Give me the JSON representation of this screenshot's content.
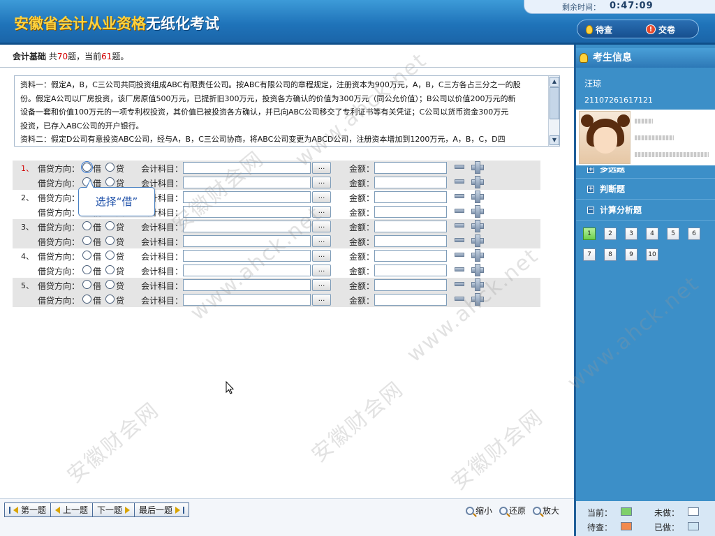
{
  "header": {
    "title_strong": "安徽省会计从业资格",
    "title_weak": "无纸化考试",
    "timer_label": "剩余时间：",
    "timer_value": "0:47:09",
    "pending_label": "待查",
    "submit_label": "交卷"
  },
  "subject": {
    "name": "会计基础",
    "text1": " 共",
    "total": "70",
    "text2": "题，当前",
    "current": "61",
    "text3": "题。"
  },
  "material": {
    "lines": [
      "资料一：假定A，B，C三公司共同投资组成ABC有限责任公司。按ABC有限公司的章程规定，注册资本为900万元，A，B，C三方各占三分之一的股",
      "份。假定A公司以厂房投资，该厂房原值500万元，已提折旧300万元，投资各方确认的价值为300万元（同公允价值）；B公司以价值200万元的新",
      "设备一套和价值100万元的一项专利权投资，其价值已被投资各方确认，并已向ABC公司移交了专利证书等有关凭证；C公司以货币资金300万元",
      "投资，已存入ABC公司的开户银行。",
      "资料二：假定D公司有意投资ABC公司，经与A，B，C三公司协商，将ABC公司变更为ABCD公司，注册资本增加到1200万元，A，B，C，D四"
    ]
  },
  "entry_labels": {
    "direction": "借贷方向：",
    "debit": "借",
    "credit": "贷",
    "account": "会计科目：",
    "amount": "金额：",
    "browse": "..."
  },
  "entries": [
    {
      "num": "1、"
    },
    {
      "num": "2、"
    },
    {
      "num": "3、"
    },
    {
      "num": "4、"
    },
    {
      "num": "5、"
    }
  ],
  "tooltip": "选择“借”",
  "nav": {
    "first": "第一题",
    "prev": "上一题",
    "next": "下一题",
    "last": "最后一题"
  },
  "zoom": {
    "zoom_out": "缩小",
    "restore": "还原",
    "zoom_in": "放大"
  },
  "sidebar": {
    "header": "考生信息",
    "name": "汪琼",
    "id": "21107261617121",
    "categories": [
      "多选题",
      "判断题",
      "计算分析题"
    ],
    "question_numbers": [
      "1",
      "2",
      "3",
      "4",
      "5",
      "6",
      "7",
      "8",
      "9",
      "10"
    ],
    "legend": {
      "current": "当前：",
      "undone": "未做：",
      "pending": "待查：",
      "done": "已做："
    }
  },
  "colors": {
    "current": "#7fd06c",
    "undone": "#ffffff",
    "pending": "#f28a4e",
    "done": "#cfe6f4"
  },
  "watermark": [
    "www.ahck.net",
    "安徽财会网"
  ]
}
